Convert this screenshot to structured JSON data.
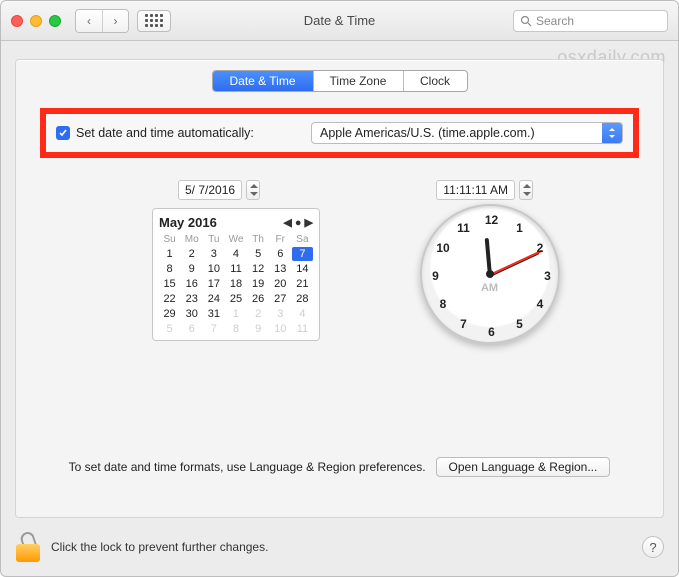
{
  "window": {
    "title": "Date & Time"
  },
  "search": {
    "placeholder": "Search"
  },
  "watermark": "osxdaily.com",
  "tabs": {
    "t0": "Date & Time",
    "t1": "Time Zone",
    "t2": "Clock"
  },
  "auto": {
    "label": "Set date and time automatically:",
    "server": "Apple Americas/U.S. (time.apple.com.)"
  },
  "date_field": "5/  7/2016",
  "time_field": "11:11:11 AM",
  "calendar": {
    "title": "May 2016",
    "weekdays": [
      "Su",
      "Mo",
      "Tu",
      "We",
      "Th",
      "Fr",
      "Sa"
    ],
    "cells": [
      {
        "n": "1"
      },
      {
        "n": "2"
      },
      {
        "n": "3"
      },
      {
        "n": "4"
      },
      {
        "n": "5"
      },
      {
        "n": "6"
      },
      {
        "n": "7",
        "sel": true
      },
      {
        "n": "8"
      },
      {
        "n": "9"
      },
      {
        "n": "10"
      },
      {
        "n": "11"
      },
      {
        "n": "12"
      },
      {
        "n": "13"
      },
      {
        "n": "14"
      },
      {
        "n": "15"
      },
      {
        "n": "16"
      },
      {
        "n": "17"
      },
      {
        "n": "18"
      },
      {
        "n": "19"
      },
      {
        "n": "20"
      },
      {
        "n": "21"
      },
      {
        "n": "22"
      },
      {
        "n": "23"
      },
      {
        "n": "24"
      },
      {
        "n": "25"
      },
      {
        "n": "26"
      },
      {
        "n": "27"
      },
      {
        "n": "28"
      },
      {
        "n": "29"
      },
      {
        "n": "30"
      },
      {
        "n": "31"
      },
      {
        "n": "1",
        "dim": true
      },
      {
        "n": "2",
        "dim": true
      },
      {
        "n": "3",
        "dim": true
      },
      {
        "n": "4",
        "dim": true
      },
      {
        "n": "5",
        "dim": true
      },
      {
        "n": "6",
        "dim": true
      },
      {
        "n": "7",
        "dim": true
      },
      {
        "n": "8",
        "dim": true
      },
      {
        "n": "9",
        "dim": true
      },
      {
        "n": "10",
        "dim": true
      },
      {
        "n": "11",
        "dim": true
      }
    ]
  },
  "clock": {
    "ampm": "AM",
    "numbers": [
      "12",
      "1",
      "2",
      "3",
      "4",
      "5",
      "6",
      "7",
      "8",
      "9",
      "10",
      "11"
    ]
  },
  "footer": {
    "text": "To set date and time formats, use Language & Region preferences.",
    "button": "Open Language & Region..."
  },
  "lock": {
    "text": "Click the lock to prevent further changes."
  },
  "help": "?"
}
